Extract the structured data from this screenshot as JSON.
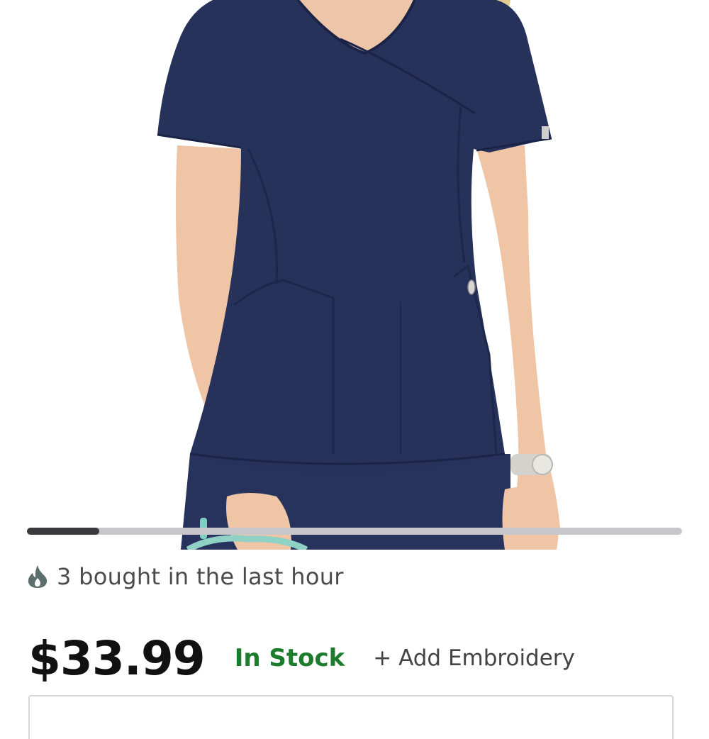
{
  "gallery": {
    "image_icon": "product-photo-navy-scrub-top",
    "progress_fraction": 0.11
  },
  "social_proof": {
    "icon": "flame-icon",
    "text": "3 bought in the last hour"
  },
  "product": {
    "price": "$33.99",
    "stock_status": "In Stock",
    "embroidery_link": "+ Add Embroidery"
  },
  "colors": {
    "scrub_navy": "#26325a",
    "stock_green": "#1b7d2c",
    "price_black": "#111111",
    "progress_fill": "#3a3a3c",
    "progress_track": "#c7c7c9"
  }
}
